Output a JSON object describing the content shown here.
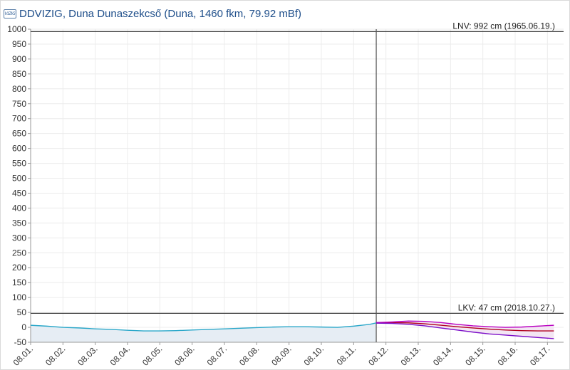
{
  "header": {
    "logo_text": "VIZIG",
    "title": "DDVIZIG, Duna Dunaszekcső (Duna, 1460 fkm, 79.92 mBf)"
  },
  "chart_data": {
    "type": "line",
    "title": "DDVIZIG, Duna Dunaszekcső (Duna, 1460 fkm, 79.92 mBf)",
    "xlabel": "",
    "ylabel": "",
    "ylim": [
      -50,
      1000
    ],
    "xlim": [
      0,
      16.5
    ],
    "yticks": [
      1000,
      950,
      900,
      850,
      800,
      750,
      700,
      650,
      600,
      550,
      500,
      450,
      400,
      350,
      300,
      250,
      200,
      150,
      100,
      50,
      0,
      -50
    ],
    "xticks": [
      "08.01.",
      "08.02.",
      "08.03.",
      "08.04.",
      "08.05.",
      "08.06.",
      "08.07.",
      "08.08.",
      "08.09.",
      "08.10.",
      "08.11.",
      "08.12.",
      "08.13.",
      "08.14.",
      "08.15.",
      "08.16.",
      "08.17."
    ],
    "grid": true,
    "now_marker_x": 10.7,
    "reference_lines": [
      {
        "value": 992,
        "label": "LNV: 992 cm (1965.06.19.)"
      },
      {
        "value": 47,
        "label": "LKV: 47 cm (2018.10.27.)"
      }
    ],
    "series": [
      {
        "color": "#2aa7c9",
        "x": [
          0,
          0.5,
          1,
          1.5,
          2,
          2.5,
          3,
          3.5,
          4,
          4.5,
          5,
          5.5,
          6,
          6.5,
          7,
          7.5,
          8,
          8.5,
          9,
          9.5,
          10,
          10.5,
          10.7
        ],
        "values": [
          7,
          4,
          0,
          -2,
          -5,
          -7,
          -10,
          -12,
          -12,
          -11,
          -9,
          -7,
          -5,
          -3,
          -1,
          1,
          2,
          2,
          1,
          0,
          4,
          10,
          15
        ]
      },
      {
        "color": "#b0001e",
        "x": [
          10.7,
          11.2,
          11.7,
          12.2,
          12.7,
          13.2,
          13.7,
          14.2,
          14.7,
          15.2,
          15.7,
          16.2
        ],
        "values": [
          15,
          16,
          15,
          12,
          7,
          2,
          -2,
          -6,
          -9,
          -11,
          -12,
          -12
        ]
      },
      {
        "color": "#b900c0",
        "x": [
          10.7,
          11.2,
          11.7,
          12.2,
          12.7,
          13.2,
          13.7,
          14.2,
          14.7,
          15.2,
          15.7,
          16.2
        ],
        "values": [
          16,
          18,
          21,
          20,
          16,
          10,
          5,
          2,
          0,
          1,
          4,
          7
        ]
      },
      {
        "color": "#7d10c8",
        "x": [
          10.7,
          11.2,
          11.7,
          12.2,
          12.7,
          13.2,
          13.7,
          14.2,
          14.7,
          15.2,
          15.7,
          16.2
        ],
        "values": [
          14,
          13,
          10,
          5,
          -2,
          -9,
          -16,
          -22,
          -26,
          -30,
          -34,
          -38
        ]
      }
    ]
  }
}
